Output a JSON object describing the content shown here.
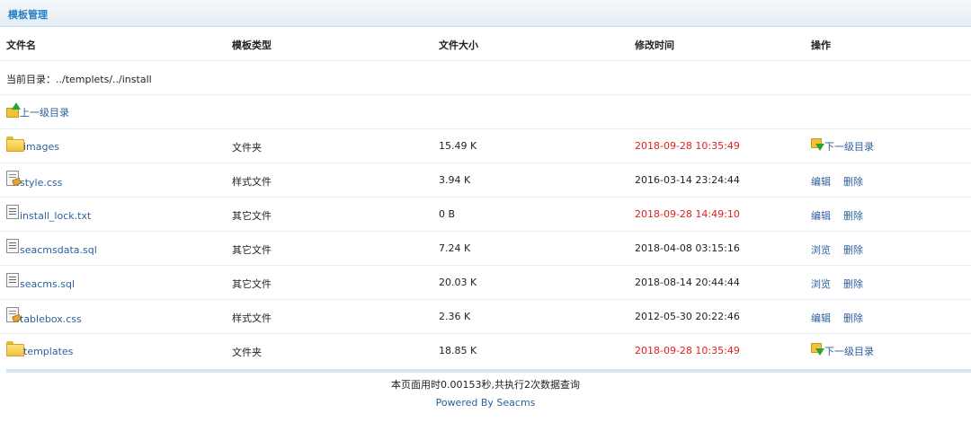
{
  "title": "模板管理",
  "columns": [
    "文件名",
    "模板类型",
    "文件大小",
    "修改时间",
    "操作"
  ],
  "current_dir": "当前目录：../templets/../install",
  "parent_dir_label": "上一级目录",
  "files": [
    {
      "name": "images",
      "type": "文件夹",
      "size": "15.49 K",
      "time": "2018-09-28 10:35:49",
      "actions": [
        "下一级目录"
      ],
      "icon": "folder-icon"
    },
    {
      "name": "style.css",
      "type": "样式文件",
      "size": "3.94 K",
      "time": "2016-03-14 23:24:44",
      "actions": [
        "编辑",
        "删除"
      ],
      "icon": "css-file-icon"
    },
    {
      "name": "install_lock.txt",
      "type": "其它文件",
      "size": "0 B",
      "time": "2018-09-28 14:49:10",
      "actions": [
        "编辑",
        "删除"
      ],
      "icon": "text-file-icon"
    },
    {
      "name": "seacmsdata.sql",
      "type": "其它文件",
      "size": "7.24 K",
      "time": "2018-04-08 03:15:16",
      "actions": [
        "浏览",
        "删除"
      ],
      "icon": "text-file-icon"
    },
    {
      "name": "seacms.sql",
      "type": "其它文件",
      "size": "20.03 K",
      "time": "2018-08-14 20:44:44",
      "actions": [
        "浏览",
        "删除"
      ],
      "icon": "text-file-icon"
    },
    {
      "name": "tablebox.css",
      "type": "样式文件",
      "size": "2.36 K",
      "time": "2012-05-30 20:22:46",
      "actions": [
        "编辑",
        "删除"
      ],
      "icon": "css-file-icon"
    },
    {
      "name": "templates",
      "type": "文件夹",
      "size": "18.85 K",
      "time": "2018-09-28 10:35:49",
      "actions": [
        "下一级目录"
      ],
      "icon": "folder-icon"
    }
  ],
  "footer": {
    "stats": "本页面用时0.00153秒,共执行2次数据查询",
    "powered": "Powered By Seacms"
  },
  "colors": {
    "accent": "#2a7fc1",
    "link": "#2c5f9e",
    "recent_time": "#e02020"
  }
}
